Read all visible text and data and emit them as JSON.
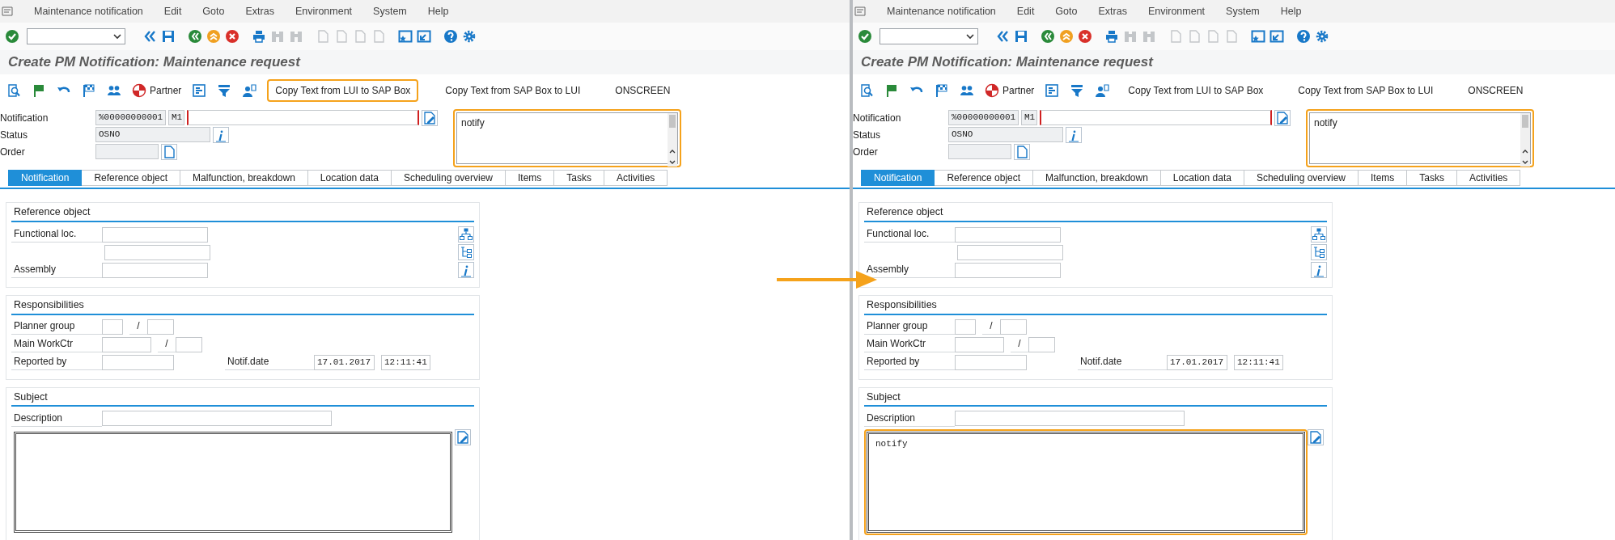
{
  "panes": [
    {
      "menu": [
        "Maintenance notification",
        "Edit",
        "Goto",
        "Extras",
        "Environment",
        "System",
        "Help"
      ],
      "toolbar_icons": [
        {
          "kind": "enter",
          "disabled": false
        },
        {
          "kind": "collapse",
          "disabled": false
        },
        {
          "kind": "save",
          "disabled": false
        },
        {
          "kind": "back",
          "disabled": false
        },
        {
          "kind": "exit",
          "disabled": false
        },
        {
          "kind": "cancel",
          "disabled": false
        },
        {
          "kind": "print",
          "disabled": false
        },
        {
          "kind": "find",
          "disabled": true
        },
        {
          "kind": "find-next",
          "disabled": true
        },
        {
          "kind": "first-page",
          "disabled": true
        },
        {
          "kind": "previous-page",
          "disabled": true
        },
        {
          "kind": "next-page",
          "disabled": true
        },
        {
          "kind": "last-page",
          "disabled": true
        },
        {
          "kind": "new-session",
          "disabled": false
        },
        {
          "kind": "shortcut",
          "disabled": false
        },
        {
          "kind": "help",
          "disabled": false
        },
        {
          "kind": "settings",
          "disabled": false
        }
      ],
      "title": "Create PM Notification: Maintenance request",
      "app_toolbar": [
        {
          "kind": "display"
        },
        {
          "kind": "flag"
        },
        {
          "kind": "undo"
        },
        {
          "kind": "checkered-flag"
        },
        {
          "kind": "partners"
        },
        {
          "kind": "partner",
          "label": "Partner"
        },
        {
          "kind": "layout"
        },
        {
          "kind": "filter"
        },
        {
          "kind": "assign"
        },
        {
          "kind": "text",
          "label": "Copy Text from LUI to SAP Box",
          "highlighted": true
        },
        {
          "kind": "text",
          "label": "Copy Text from SAP Box to LUI",
          "highlighted": false
        },
        {
          "kind": "text",
          "label": "ONSCREEN",
          "highlighted": false
        }
      ],
      "header": {
        "notification": {
          "label": "Notification",
          "number": "%00000000001",
          "type": "M1"
        },
        "status": {
          "label": "Status",
          "value": "OSNO"
        },
        "order": {
          "label": "Order"
        }
      },
      "notes_box": {
        "text": "notify",
        "highlighted": true
      },
      "tabs": [
        {
          "label": "Notification",
          "selected": true
        },
        {
          "label": "Reference object",
          "selected": false
        },
        {
          "label": "Malfunction, breakdown",
          "selected": false
        },
        {
          "label": "Location data",
          "selected": false
        },
        {
          "label": "Scheduling overview",
          "selected": false
        },
        {
          "label": "Items",
          "selected": false
        },
        {
          "label": "Tasks",
          "selected": false
        },
        {
          "label": "Activities",
          "selected": false
        }
      ],
      "reference_object": {
        "title": "Reference object",
        "rows": [
          {
            "kind": "labeled",
            "label": "Functional loc."
          },
          {
            "kind": "continuation"
          },
          {
            "kind": "labeled",
            "label": "Assembly"
          }
        ]
      },
      "responsibilities": {
        "title": "Responsibilities",
        "planner_group": {
          "label": "Planner group",
          "separator": "/"
        },
        "main_workctr": {
          "label": "Main WorkCtr",
          "separator": "/"
        },
        "reported_by": {
          "label": "Reported by"
        },
        "notif_date": {
          "label": "Notif.date",
          "date": "17.01.2017",
          "time": "12:11:41"
        }
      },
      "subject": {
        "title": "Subject",
        "description": {
          "label": "Description"
        },
        "long_text": {
          "highlighted": false
        }
      }
    },
    {
      "menu": [
        "Maintenance notification",
        "Edit",
        "Goto",
        "Extras",
        "Environment",
        "System",
        "Help"
      ],
      "toolbar_icons": [
        {
          "kind": "enter",
          "disabled": false
        },
        {
          "kind": "collapse",
          "disabled": false
        },
        {
          "kind": "save",
          "disabled": false
        },
        {
          "kind": "back",
          "disabled": false
        },
        {
          "kind": "exit",
          "disabled": false
        },
        {
          "kind": "cancel",
          "disabled": false
        },
        {
          "kind": "print",
          "disabled": false
        },
        {
          "kind": "find",
          "disabled": true
        },
        {
          "kind": "find-next",
          "disabled": true
        },
        {
          "kind": "first-page",
          "disabled": true
        },
        {
          "kind": "previous-page",
          "disabled": true
        },
        {
          "kind": "next-page",
          "disabled": true
        },
        {
          "kind": "last-page",
          "disabled": true
        },
        {
          "kind": "new-session",
          "disabled": false
        },
        {
          "kind": "shortcut",
          "disabled": false
        },
        {
          "kind": "help",
          "disabled": false
        },
        {
          "kind": "settings",
          "disabled": false
        }
      ],
      "title": "Create PM Notification: Maintenance request",
      "app_toolbar": [
        {
          "kind": "display"
        },
        {
          "kind": "flag"
        },
        {
          "kind": "undo"
        },
        {
          "kind": "checkered-flag"
        },
        {
          "kind": "partners"
        },
        {
          "kind": "partner",
          "label": "Partner"
        },
        {
          "kind": "layout"
        },
        {
          "kind": "filter"
        },
        {
          "kind": "assign"
        },
        {
          "kind": "text",
          "label": "Copy Text from LUI to SAP Box",
          "highlighted": false
        },
        {
          "kind": "text",
          "label": "Copy Text from SAP Box to LUI",
          "highlighted": false
        },
        {
          "kind": "text",
          "label": "ONSCREEN",
          "highlighted": false
        }
      ],
      "header": {
        "notification": {
          "label": "Notification",
          "number": "%00000000001",
          "type": "M1"
        },
        "status": {
          "label": "Status",
          "value": "OSNO"
        },
        "order": {
          "label": "Order"
        }
      },
      "notes_box": {
        "text": "notify",
        "highlighted": true
      },
      "tabs": [
        {
          "label": "Notification",
          "selected": true
        },
        {
          "label": "Reference object",
          "selected": false
        },
        {
          "label": "Malfunction, breakdown",
          "selected": false
        },
        {
          "label": "Location data",
          "selected": false
        },
        {
          "label": "Scheduling overview",
          "selected": false
        },
        {
          "label": "Items",
          "selected": false
        },
        {
          "label": "Tasks",
          "selected": false
        },
        {
          "label": "Activities",
          "selected": false
        }
      ],
      "reference_object": {
        "title": "Reference object",
        "rows": [
          {
            "kind": "labeled",
            "label": "Functional loc."
          },
          {
            "kind": "continuation"
          },
          {
            "kind": "labeled",
            "label": "Assembly"
          }
        ]
      },
      "responsibilities": {
        "title": "Responsibilities",
        "planner_group": {
          "label": "Planner group",
          "separator": "/"
        },
        "main_workctr": {
          "label": "Main WorkCtr",
          "separator": "/"
        },
        "reported_by": {
          "label": "Reported by"
        },
        "notif_date": {
          "label": "Notif.date",
          "date": "17.01.2017",
          "time": "12:11:41"
        }
      },
      "subject": {
        "title": "Subject",
        "description": {
          "label": "Description"
        },
        "long_text": {
          "text": "notify",
          "highlighted": true
        }
      }
    }
  ]
}
